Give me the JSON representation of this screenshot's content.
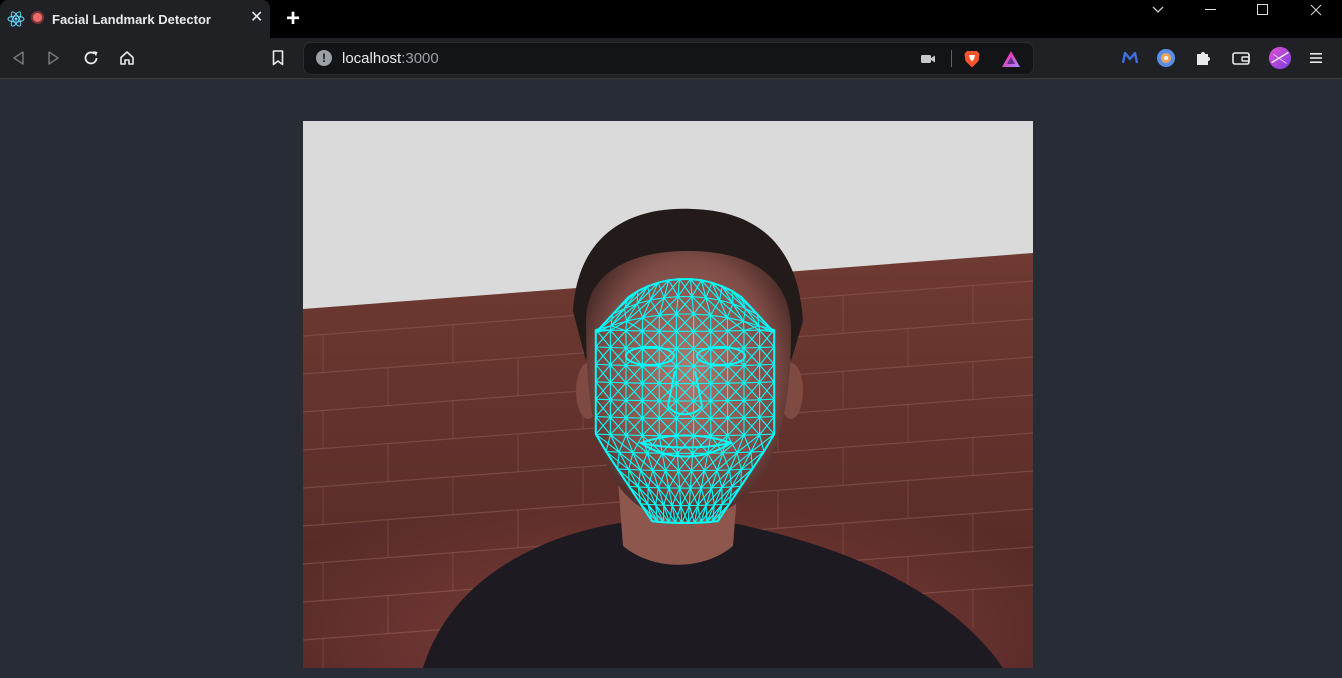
{
  "browser": {
    "tab": {
      "title": "Facial Landmark Detector"
    },
    "address": {
      "host": "localhost",
      "port": ":3000"
    }
  },
  "icons": {
    "tab_favicon": "react-logo-icon",
    "recording": "recording-dot-icon",
    "close_tab": "close-icon",
    "new_tab": "plus-icon",
    "back": "back-arrow-icon",
    "forward": "forward-arrow-icon",
    "reload": "reload-icon",
    "home": "home-icon",
    "bookmark": "bookmark-icon",
    "site_info": "info-icon",
    "camera": "camera-icon",
    "brave_shields": "brave-lion-icon",
    "brave_rewards": "rewards-triangle-icon",
    "ext_metamask": "m-extension-icon",
    "ext_blue": "blue-extension-icon",
    "extensions": "puzzle-piece-icon",
    "wallet": "wallet-icon",
    "profile": "profile-avatar",
    "menu": "hamburger-menu-icon"
  },
  "colors": {
    "page_bg": "#282c34",
    "mesh": "#00ffff",
    "wall_brick": "#6a3630",
    "background_wall": "#dadada"
  },
  "mesh": {
    "rows": 14,
    "cols": 11
  }
}
